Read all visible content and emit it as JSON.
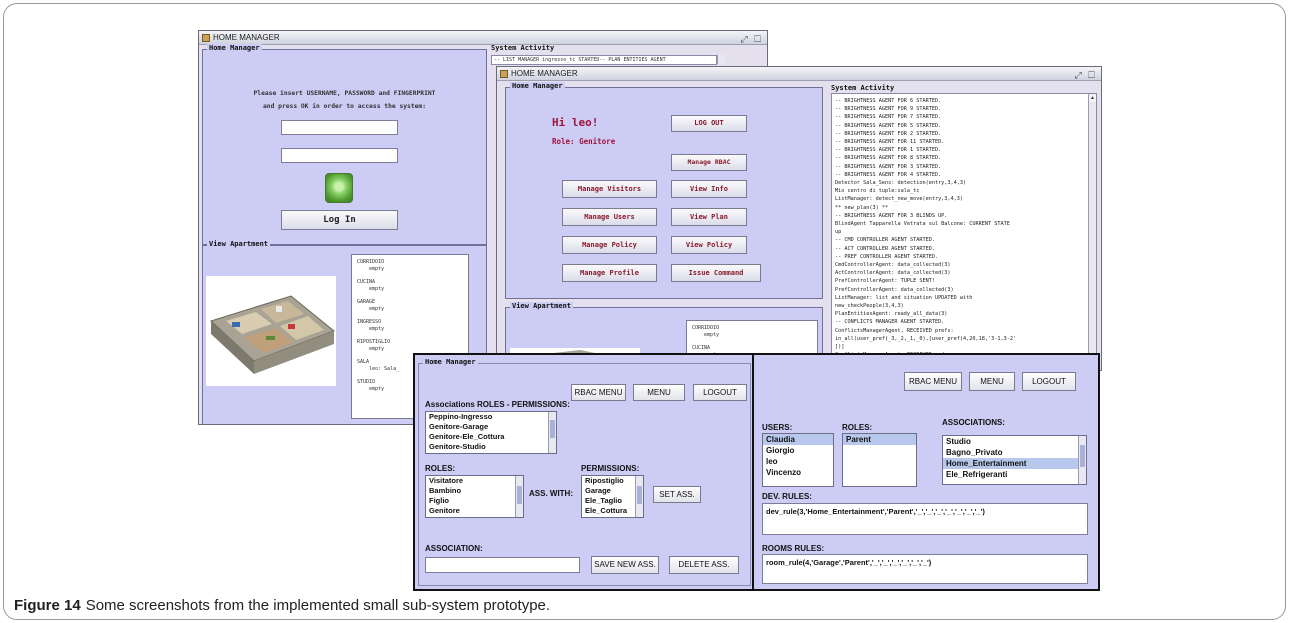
{
  "caption": {
    "label": "Figure 14",
    "text": "Some screenshots from the implemented small sub-system prototype."
  },
  "login_window": {
    "title": "HOME MANAGER",
    "home_panel_label": "Home Manager",
    "prompt_line1": "Please insert USERNAME, PASSWORD and FINGERPRINT",
    "prompt_line2": "and press OK in order to access the system:",
    "username_value": "",
    "password_value": "",
    "login_button": "Log In",
    "view_panel_label": "View Apartment",
    "system_activity_label": "System Activity",
    "system_activity_text": "-- LIST MANAGER ingresso_tc STARTED-- PLAN ENTITIES AGENT",
    "rooms": [
      {
        "name": "CORRIDOIO",
        "status": "empty"
      },
      {
        "name": "CUCINA",
        "status": "empty"
      },
      {
        "name": "GARAGE",
        "status": "empty"
      },
      {
        "name": "INGRESSO",
        "status": "empty"
      },
      {
        "name": "RIPOSTIGLIO",
        "status": "empty"
      },
      {
        "name": "SALA",
        "status": "leo: Sala_"
      },
      {
        "name": "STUDIO",
        "status": "empty"
      }
    ]
  },
  "main_window": {
    "title": "HOME MANAGER",
    "home_panel_label": "Home Manager",
    "greeting": "Hi leo!",
    "role": "Role: Genitore",
    "buttons": {
      "logout": "LOG OUT",
      "manage_rbac": "Manage RBAC",
      "manage_visitors": "Manage Visitors",
      "view_info": "View Info",
      "manage_users": "Manage Users",
      "view_plan": "View Plan",
      "manage_policy": "Manage Policy",
      "view_policy": "View Policy",
      "manage_profile": "Manage Profile",
      "issue_command": "Issue Command"
    },
    "view_panel_label": "View Apartment",
    "rooms": [
      {
        "name": "CORRIDOIO",
        "status": "empty"
      },
      {
        "name": "CUCINA",
        "status": "empty"
      }
    ],
    "system_activity_label": "System Activity",
    "activity_log": [
      "-- BRIGHTNESS AGENT FOR 6 STARTED.",
      "-- BRIGHTNESS AGENT FOR 9 STARTED.",
      "-- BRIGHTNESS AGENT FOR 7 STARTED.",
      "-- BRIGHTNESS AGENT FOR 5 STARTED.",
      "-- BRIGHTNESS AGENT FOR 2 STARTED.",
      "-- BRIGHTNESS AGENT FOR 11 STARTED.",
      "-- BRIGHTNESS AGENT FOR 1 STARTED.",
      "-- BRIGHTNESS AGENT FOR 8 STARTED.",
      "-- BRIGHTNESS AGENT FOR 3 STARTED.",
      "-- BRIGHTNESS AGENT FOR 4 STARTED.",
      "Detector Sala_Sens: detection(entry,3,4,3)",
      "Mio centro di tuple:sala_tc",
      "ListManager: detect_new_move(entry,3,4,3)",
      "** new_plan(3) **",
      "-- BRIGHTNESS AGENT FOR 3 BLINDS UP.",
      "BlindAgent Tapparella Vetrata sul Balcone: CURRENT STATE",
      "up",
      "-- CMD CONTROLLER AGENT STARTED.",
      "-- ACT CONTROLLER AGENT STARTED.",
      "-- PREF CONTROLLER AGENT STARTED.",
      "CmdControllerAgent: data_collected(3)",
      "ActControllerAgent: data_collected(3)",
      "PrefControllerAgent: TUPLE SENT!",
      "PrefControllerAgent: data_collected(3)",
      "ListManager: list and situation UPDATED with",
      "new_checkPeople(3,4,3)",
      "PlanEntitiesAgent: ready_all_data(3)",
      "-- CONFLICTS MANAGER AGENT STARTED.",
      "ConflictsManagerAgent, RECEIVED prefs:",
      "in_all(user_pref(_3,_2,_1,_0),[user_pref(4,20,18,'3-1,3-2'",
      "])]",
      "ConflictsManagerAgent, RECEIVED cmds:"
    ]
  },
  "rbac_window": {
    "panel_label": "Home Manager",
    "buttons": {
      "rbac_menu": "RBAC MENU",
      "menu": "MENU",
      "logout": "LOGOUT"
    },
    "assoc_label": "Associations ROLES - PERMISSIONS:",
    "associations": [
      "Peppino-Ingresso",
      "Genitore-Garage",
      "Genitore-Ele_Cottura",
      "Genitore-Studio"
    ],
    "roles_label": "ROLES:",
    "roles": [
      "Visitatore",
      "Bambino",
      "Figlio",
      "Genitore"
    ],
    "ass_with_label": "ASS. WITH:",
    "permissions_label": "PERMISSIONS:",
    "permissions": [
      "Ripostiglio",
      "Garage",
      "Ele_Taglio",
      "Ele_Cottura"
    ],
    "set_ass_button": "SET ASS.",
    "association_label": "ASSOCIATION:",
    "association_value": "",
    "save_button": "SAVE NEW ASS.",
    "delete_button": "DELETE ASS."
  },
  "rules_window": {
    "buttons": {
      "rbac_menu": "RBAC MENU",
      "menu": "MENU",
      "logout": "LOGOUT"
    },
    "users_label": "USERS:",
    "users": [
      "Claudia",
      "Giorgio",
      "leo",
      "Vincenzo"
    ],
    "selected_user": "Claudia",
    "roles_label": "ROLES:",
    "roles": [
      "Parent"
    ],
    "associations_label": "ASSOCIATIONS:",
    "associations": [
      "Studio",
      "Bagno_Privato",
      "Home_Entertainment",
      "Ele_Refrigeranti"
    ],
    "selected_association": "Home_Entertainment",
    "dev_rules_label": "DEV. RULES:",
    "dev_rule": "dev_rule(3,'Home_Entertainment','Parent','_','_','_','_','_','_','_')",
    "rooms_rules_label": "ROOMS RULES:",
    "room_rule": "room_rule(4,'Garage','Parent','_','_','_','_','_','_')"
  }
}
